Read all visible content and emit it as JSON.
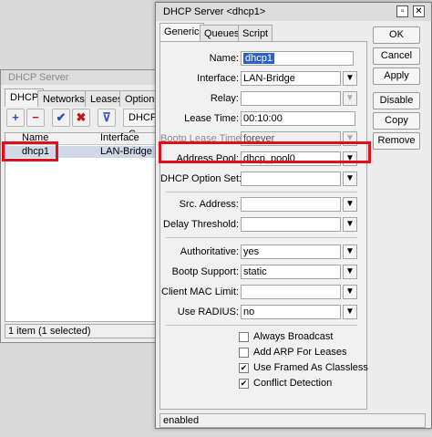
{
  "bg_window": {
    "title": "DHCP Server",
    "tabs": [
      "DHCP",
      "Networks",
      "Leases",
      "Options"
    ],
    "filter_label": "DHCP C",
    "columns": [
      "Name",
      "Interface"
    ],
    "row": {
      "name": "dhcp1",
      "interface": "LAN-Bridge"
    },
    "status": "1 item (1 selected)"
  },
  "dialog": {
    "title": "DHCP Server <dhcp1>",
    "tabs": [
      "Generic",
      "Queues",
      "Script"
    ],
    "fields": {
      "name": {
        "label": "Name:",
        "value": "dhcp1"
      },
      "interface": {
        "label": "Interface:",
        "value": "LAN-Bridge"
      },
      "relay": {
        "label": "Relay:",
        "value": ""
      },
      "lease_time": {
        "label": "Lease Time:",
        "value": "00:10:00"
      },
      "bootp_lease_time": {
        "label": "Bootp Lease Time:",
        "value": "forever"
      },
      "address_pool": {
        "label": "Address Pool:",
        "value": "dhcp_pool0"
      },
      "dhcp_option_set": {
        "label": "DHCP Option Set:",
        "value": ""
      },
      "src_address": {
        "label": "Src. Address:",
        "value": ""
      },
      "delay_threshold": {
        "label": "Delay Threshold:",
        "value": ""
      },
      "authoritative": {
        "label": "Authoritative:",
        "value": "yes"
      },
      "bootp_support": {
        "label": "Bootp Support:",
        "value": "static"
      },
      "client_mac_limit": {
        "label": "Client MAC Limit:",
        "value": ""
      },
      "use_radius": {
        "label": "Use RADIUS:",
        "value": "no"
      }
    },
    "checkboxes": {
      "always_broadcast": {
        "label": "Always Broadcast",
        "checked": false
      },
      "add_arp": {
        "label": "Add ARP For Leases",
        "checked": false
      },
      "use_framed": {
        "label": "Use Framed As Classless",
        "checked": true
      },
      "conflict_detection": {
        "label": "Conflict Detection",
        "checked": true
      }
    },
    "buttons": {
      "ok": "OK",
      "cancel": "Cancel",
      "apply": "Apply",
      "disable": "Disable",
      "copy": "Copy",
      "remove": "Remove"
    },
    "status": "enabled"
  },
  "glyphs": {
    "minimize": "▫",
    "close": "✕",
    "dropdown": "▼",
    "check": "✔",
    "add": "+",
    "remove": "−",
    "enable": "✔",
    "disable": "✖",
    "filter": "⊽"
  },
  "colors": {
    "highlight_box": "#e0101a",
    "selection": "#2a62c8"
  }
}
